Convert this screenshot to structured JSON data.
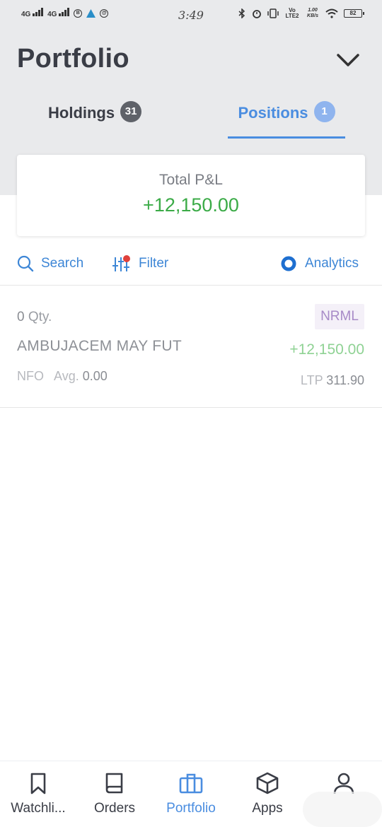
{
  "status_bar": {
    "net1": "4G",
    "net2": "4G",
    "time": "3:49",
    "volte": "Vo LTE2",
    "speed": "1.00 KB/s",
    "battery": "82"
  },
  "header": {
    "title": "Portfolio",
    "tabs": [
      {
        "label": "Holdings",
        "count": "31",
        "active": false
      },
      {
        "label": "Positions",
        "count": "1",
        "active": true
      }
    ]
  },
  "pnl_card": {
    "label": "Total P&L",
    "value": "+12,150.00"
  },
  "toolbar": {
    "search_label": "Search",
    "filter_label": "Filter",
    "analytics_label": "Analytics"
  },
  "positions": [
    {
      "qty": "0",
      "qty_suffix": "Qty.",
      "symbol": "AMBUJACEM MAY FUT",
      "exchange": "NFO",
      "avg_label": "Avg.",
      "avg_value": "0.00",
      "product": "NRML",
      "pnl": "+12,150.00",
      "ltp_label": "LTP",
      "ltp_value": "311.90"
    }
  ],
  "bottom_nav": [
    {
      "label": "Watchli...",
      "icon": "bookmark-icon",
      "active": false
    },
    {
      "label": "Orders",
      "icon": "book-icon",
      "active": false
    },
    {
      "label": "Portfolio",
      "icon": "briefcase-icon",
      "active": true
    },
    {
      "label": "Apps",
      "icon": "cube-icon",
      "active": false
    },
    {
      "label": "",
      "icon": "user-icon",
      "active": false
    }
  ],
  "colors": {
    "accent": "#4a8de0",
    "profit": "#3bab47",
    "header_bg": "#e9eaec"
  }
}
